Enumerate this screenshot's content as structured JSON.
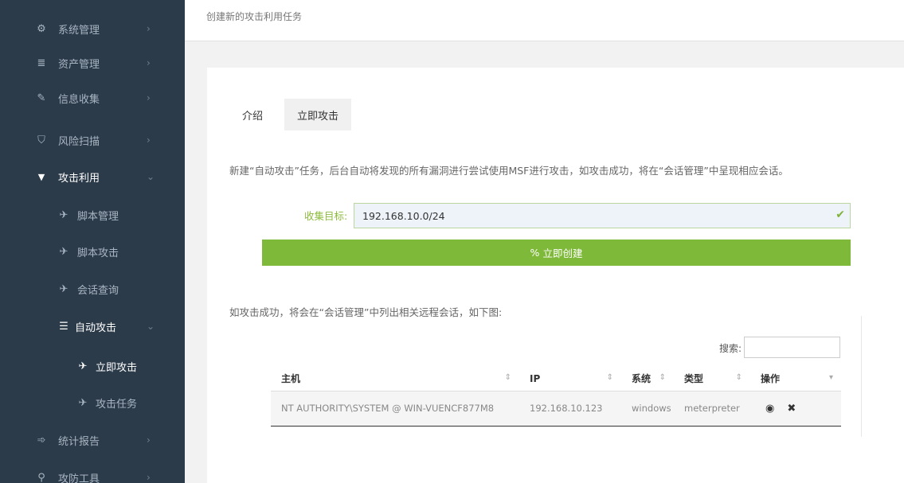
{
  "sidebar": {
    "items": [
      {
        "label": "系统管理",
        "icon": "gear-icon",
        "glyph": "⚙"
      },
      {
        "label": "资产管理",
        "icon": "database-icon",
        "glyph": "≣"
      },
      {
        "label": "信息收集",
        "icon": "pen-icon",
        "glyph": "✎"
      },
      {
        "label": "风险扫描",
        "icon": "shield-icon",
        "glyph": "⛉"
      },
      {
        "label": "攻击利用",
        "icon": "diamond-icon",
        "glyph": "▼"
      },
      {
        "label": "脚本管理",
        "icon": "plane-icon",
        "glyph": "✈"
      },
      {
        "label": "脚本攻击",
        "icon": "plane-icon",
        "glyph": "✈"
      },
      {
        "label": "会话查询",
        "icon": "plane-icon",
        "glyph": "✈"
      },
      {
        "label": "自动攻击",
        "icon": "list-icon",
        "glyph": "☰"
      },
      {
        "label": "立即攻击",
        "icon": "plane-icon",
        "glyph": "✈"
      },
      {
        "label": "攻击任务",
        "icon": "plane-icon",
        "glyph": "✈"
      },
      {
        "label": "统计报告",
        "icon": "chart-icon",
        "glyph": "➾"
      },
      {
        "label": "攻防工具",
        "icon": "wrench-icon",
        "glyph": "⚲"
      }
    ],
    "chevron_right": "›",
    "chevron_down": "⌄"
  },
  "header": {
    "breadcrumb": "创建新的攻击利用任务"
  },
  "tabs": {
    "intro": "介绍",
    "attack": "立即攻击"
  },
  "form": {
    "description": "新建“自动攻击”任务，后台自动将发现的所有漏洞进行尝试使用MSF进行攻击，如攻击成功，将在“会话管理”中呈现相应会话。",
    "target_label": "收集目标:",
    "target_value": "192.168.10.0/24",
    "create_button": "立即创建",
    "create_icon": "%"
  },
  "result": {
    "description": "如攻击成功，将会在“会话管理”中列出相关远程会话，如下图:",
    "search_label": "搜索:",
    "columns": [
      "主机",
      "IP",
      "系统",
      "类型",
      "操作"
    ],
    "rows": [
      {
        "host": "NT AUTHORITY\\SYSTEM @ WIN-VUENCF877M8",
        "ip": "192.168.10.123",
        "os": "windows",
        "type": "meterpreter"
      }
    ]
  },
  "colors": {
    "sidebar_bg": "#2c3b4a",
    "accent_green": "#7fb939"
  }
}
